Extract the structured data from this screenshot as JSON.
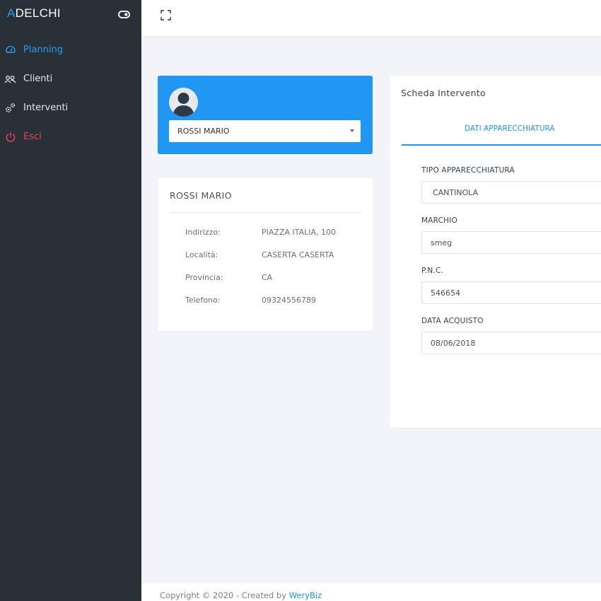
{
  "app": {
    "brand_first": "A",
    "brand_rest": "DELCHI",
    "accent_color": "#2196f3"
  },
  "sidebar": {
    "items": [
      {
        "label": "Planning",
        "icon": "speedometer-icon",
        "state": "active"
      },
      {
        "label": "Clienti",
        "icon": "users-icon",
        "state": "normal"
      },
      {
        "label": "Interventi",
        "icon": "gears-icon",
        "state": "normal"
      },
      {
        "label": "Esci",
        "icon": "power-icon",
        "state": "danger"
      }
    ]
  },
  "customer": {
    "selected": "ROSSI MARIO",
    "name": "ROSSI MARIO",
    "details": [
      {
        "label": "Indirizzo:",
        "value": "PIAZZA ITALIA, 100"
      },
      {
        "label": "Località:",
        "value": "CASERTA CASERTA"
      },
      {
        "label": "Provincia:",
        "value": "CA"
      },
      {
        "label": "Telefono:",
        "value": "09324556789"
      }
    ]
  },
  "scheda": {
    "title": "Scheda Intervento",
    "tab": "DATI APPARECCHIATURA",
    "fields": [
      {
        "label": "TIPO APPARECCHIATURA",
        "value": "CANTINOLA"
      },
      {
        "label": "MARCHIO",
        "value": "smeg"
      },
      {
        "label": "P.N.C.",
        "value": "546654"
      },
      {
        "label": "DATA ACQUISTO",
        "value": "08/06/2018"
      }
    ]
  },
  "footer": {
    "text": "Copyright © 2020 - Created by ",
    "link": "WeryBiz"
  }
}
